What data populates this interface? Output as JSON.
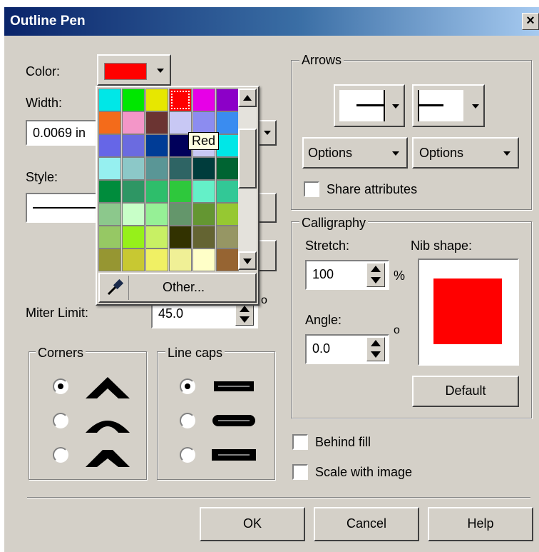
{
  "window": {
    "title": "Outline Pen",
    "close_glyph": "×"
  },
  "pen": {
    "color_label": "Color:",
    "color_value": "#ff0000",
    "width_label": "Width:",
    "width_value": "0.0069 in",
    "style_label": "Style:",
    "miter_label": "Miter Limit:",
    "miter_value": "45.0",
    "degree_symbol": "o"
  },
  "palette": {
    "swatches": [
      [
        "#00e7e7",
        "#00e700",
        "#e7e700",
        "#ff0000",
        "#e700e7",
        "#8c00c8"
      ],
      [
        "#f46b1a",
        "#f396c8",
        "#6b3432",
        "#c8c8f4",
        "#8c8cf0",
        "#3a8cf0"
      ],
      [
        "#6666e7",
        "#6b6be0",
        "#003c96",
        "#00005a",
        "#c8c8f4",
        "#00e7e7"
      ],
      [
        "#96f0f0",
        "#8cc8c8",
        "#5a9696",
        "#2e6464",
        "#003c3c",
        "#006432"
      ],
      [
        "#008c3c",
        "#2e9664",
        "#2ebe6b",
        "#2ec83c",
        "#64f0c8",
        "#32c896"
      ],
      [
        "#8cc88c",
        "#c8ffc8",
        "#96f096",
        "#64966b",
        "#649632",
        "#96c832"
      ],
      [
        "#96c864",
        "#96f01a",
        "#c8f064",
        "#323200",
        "#646432",
        "#969664"
      ],
      [
        "#969632",
        "#c8c832",
        "#f0f064",
        "#f0f096",
        "#ffffc8",
        "#966432"
      ]
    ],
    "selected": "Red",
    "other_label": "Other...",
    "eyedropper": "eyedropper-icon"
  },
  "arrows": {
    "group_label": "Arrows",
    "options_left": "Options",
    "options_right": "Options",
    "share_label": "Share attributes"
  },
  "calligraphy": {
    "group_label": "Calligraphy",
    "stretch_label": "Stretch:",
    "stretch_value": "100",
    "percent": "%",
    "nib_label": "Nib shape:",
    "angle_label": "Angle:",
    "angle_value": "0.0",
    "degree_symbol": "o",
    "default_label": "Default"
  },
  "corners": {
    "group_label": "Corners",
    "selected_index": 0
  },
  "linecaps": {
    "group_label": "Line caps",
    "selected_index": 0
  },
  "options": {
    "behind_fill": "Behind fill",
    "scale_with_image": "Scale with image"
  },
  "buttons": {
    "ok": "OK",
    "cancel": "Cancel",
    "help": "Help"
  }
}
